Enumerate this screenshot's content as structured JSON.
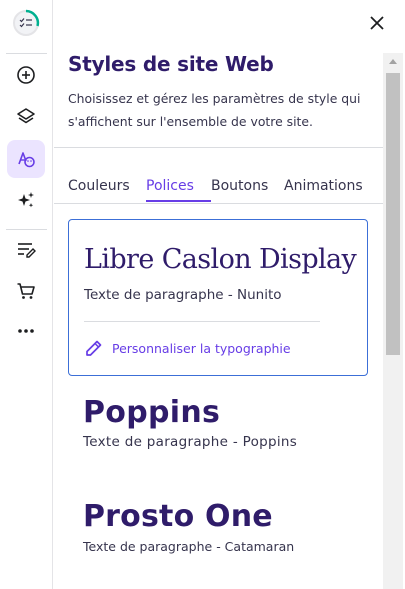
{
  "rail": {
    "items": [
      {
        "name": "add-icon"
      },
      {
        "name": "layers-icon"
      },
      {
        "name": "styles-icon",
        "active": true
      },
      {
        "name": "ai-sparkle-icon"
      },
      {
        "name": "blog-edit-icon"
      },
      {
        "name": "cart-icon"
      },
      {
        "name": "more-icon"
      }
    ]
  },
  "panel": {
    "title": "Styles de site Web",
    "description": "Choisissez et gérez les paramètres de style qui s'affichent sur l'ensemble de votre site.",
    "tabs": [
      {
        "label": "Couleurs"
      },
      {
        "label": "Polices",
        "active": true
      },
      {
        "label": "Boutons"
      },
      {
        "label": "Animations"
      }
    ]
  },
  "fonts": {
    "selected": {
      "heading_font": "Libre Caslon Display",
      "paragraph_label": "Texte de paragraphe - Nunito",
      "customize_label": "Personnaliser la typographie"
    },
    "options": [
      {
        "heading_font": "Poppins",
        "paragraph_label": "Texte de paragraphe - Poppins"
      },
      {
        "heading_font": "Prosto One",
        "paragraph_label": "Texte de paragraphe - Catamaran"
      }
    ]
  },
  "colors": {
    "accent": "#673de6",
    "title": "#2f1c6a",
    "selected_border": "#3c6fd7"
  }
}
